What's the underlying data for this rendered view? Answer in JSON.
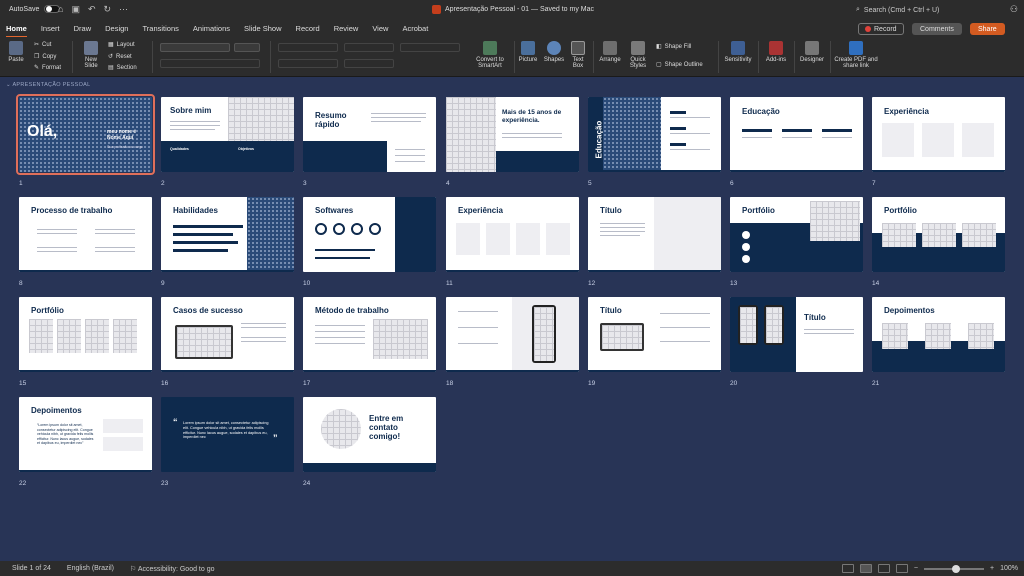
{
  "window": {
    "autosave_label": "AutoSave",
    "title": "Apresentação Pessoal - 01 — Saved to my Mac",
    "search_placeholder": "Search (Cmd + Ctrl + U)"
  },
  "tabs": [
    "Home",
    "Insert",
    "Draw",
    "Design",
    "Transitions",
    "Animations",
    "Slide Show",
    "Record",
    "Review",
    "View",
    "Acrobat"
  ],
  "header_buttons": {
    "record": "Record",
    "comments": "Comments",
    "share": "Share"
  },
  "ribbon": {
    "paste": "Paste",
    "cut": "Cut",
    "copy": "Copy",
    "format": "Format",
    "new_slide": "New Slide",
    "layout": "Layout",
    "reset": "Reset",
    "section": "Section",
    "convert_smartart": "Convert to SmartArt",
    "picture": "Picture",
    "shapes": "Shapes",
    "text_box": "Text Box",
    "arrange": "Arrange",
    "quick_styles": "Quick Styles",
    "shape_fill": "Shape Fill",
    "shape_outline": "Shape Outline",
    "sensitivity": "Sensitivity",
    "addins": "Add-ins",
    "designer": "Designer",
    "create_pdf": "Create PDF and share link"
  },
  "section_name": "APRESENTAÇÃO PESSOAL",
  "slides": [
    {
      "num": "1",
      "title": "Olá,",
      "sub": "meu nome é Nome Aqui",
      "sub2": "Sua profissão ou cargo"
    },
    {
      "num": "2",
      "title": "Sobre mim",
      "a": "Qualidades",
      "b": "Objetivos"
    },
    {
      "num": "3",
      "title": "Resumo rápido"
    },
    {
      "num": "4",
      "title": "Mais de 15 anos de experiência."
    },
    {
      "num": "5",
      "title": "Educação"
    },
    {
      "num": "6",
      "title": "Educação"
    },
    {
      "num": "7",
      "title": "Experiência"
    },
    {
      "num": "8",
      "title": "Processo de trabalho"
    },
    {
      "num": "9",
      "title": "Habilidades"
    },
    {
      "num": "10",
      "title": "Softwares"
    },
    {
      "num": "11",
      "title": "Experiência"
    },
    {
      "num": "12",
      "title": "Título"
    },
    {
      "num": "13",
      "title": "Portfólio"
    },
    {
      "num": "14",
      "title": "Portfólio"
    },
    {
      "num": "15",
      "title": "Portfólio"
    },
    {
      "num": "16",
      "title": "Casos de sucesso"
    },
    {
      "num": "17",
      "title": "Método de trabalho"
    },
    {
      "num": "18",
      "title": ""
    },
    {
      "num": "19",
      "title": "Título"
    },
    {
      "num": "20",
      "title": "Título"
    },
    {
      "num": "21",
      "title": "Depoimentos"
    },
    {
      "num": "22",
      "title": "Depoimentos",
      "quote": "“Lorem ipsum dolor sit amet, consectetur adipiscing elit. Congue vehicula nibh, ut gravida felis mollis efficitur. Nunc lacus augue, sodales et dapibus eu, imperdiet nec”"
    },
    {
      "num": "23",
      "title": "",
      "quote": "Lorem ipsum dolor sit amet, consectetur adipiscing elit. Congue vehicula nibh, ut gravida felis mollis efficitur. Nunc lacus augue, sodales et dapibus eu, imperdiet nec"
    },
    {
      "num": "24",
      "title": "Entre em contato comigo!"
    }
  ],
  "status": {
    "slide_of": "Slide 1 of 24",
    "language": "English (Brazil)",
    "accessibility": "Accessibility: Good to go",
    "zoom": "100%"
  },
  "colors": {
    "navy": "#0e2a4d",
    "canvas": "#283456",
    "accent": "#d35b21"
  }
}
